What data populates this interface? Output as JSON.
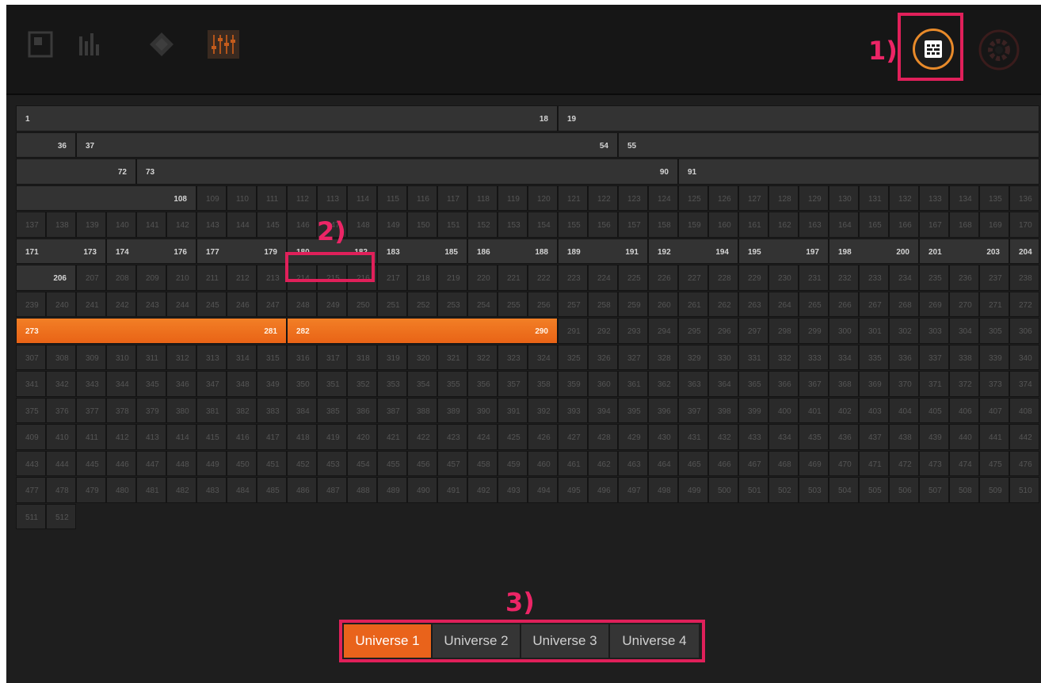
{
  "toolbar": {
    "icons": [
      "window-icon",
      "bars-icon",
      "diamond-icon",
      "faders-icon",
      "grid-icon",
      "settings-icon"
    ],
    "accent_color": "#e88a2a"
  },
  "annotations": {
    "callout_1": "1)",
    "callout_2": "2)",
    "callout_3": "3)",
    "color": "#e0205a"
  },
  "grid": {
    "channels_per_row": 34,
    "total_channels": 512,
    "fixtures": [
      {
        "start": 1,
        "end": 18
      },
      {
        "start": 19,
        "end": 36
      },
      {
        "start": 37,
        "end": 54
      },
      {
        "start": 55,
        "end": 72
      },
      {
        "start": 73,
        "end": 90
      },
      {
        "start": 91,
        "end": 108
      },
      {
        "start": 171,
        "end": 173
      },
      {
        "start": 174,
        "end": 176
      },
      {
        "start": 177,
        "end": 179
      },
      {
        "start": 180,
        "end": 182
      },
      {
        "start": 183,
        "end": 185
      },
      {
        "start": 186,
        "end": 188
      },
      {
        "start": 189,
        "end": 191
      },
      {
        "start": 192,
        "end": 194
      },
      {
        "start": 195,
        "end": 197
      },
      {
        "start": 198,
        "end": 200
      },
      {
        "start": 201,
        "end": 203
      },
      {
        "start": 204,
        "end": 206
      },
      {
        "start": 273,
        "end": 281,
        "selected": true
      },
      {
        "start": 282,
        "end": 290,
        "selected": true
      }
    ],
    "colors": {
      "selected": "#ef741f",
      "assigned": "#333333",
      "empty": "#2a2a2a"
    }
  },
  "universes": {
    "tabs": [
      "Universe 1",
      "Universe 2",
      "Universe 3",
      "Universe 4"
    ],
    "active": "Universe 1"
  }
}
